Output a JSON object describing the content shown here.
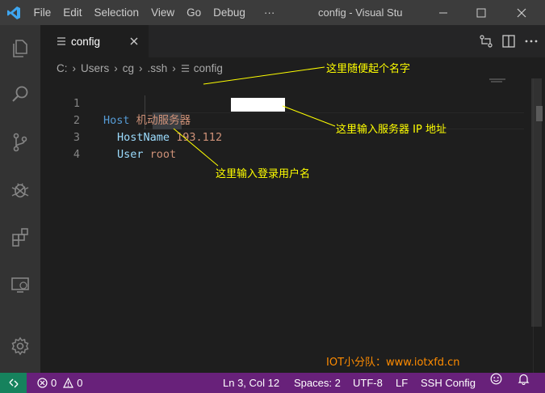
{
  "window": {
    "title": "config - Visual Stu",
    "menu": [
      "File",
      "Edit",
      "Selection",
      "View",
      "Go",
      "Debug",
      "···"
    ]
  },
  "activitybar": {
    "icons": [
      "files-icon",
      "search-icon",
      "source-control-icon",
      "debug-icon",
      "extensions-icon",
      "remote-explorer-icon",
      "settings-gear-icon"
    ]
  },
  "tab": {
    "label": "config",
    "close": "×"
  },
  "breadcrumbs": {
    "parts": [
      "C:",
      "Users",
      "cg",
      ".ssh"
    ],
    "file": "config"
  },
  "editor": {
    "lines": [
      {
        "num": "1",
        "key": "Host",
        "value": "机动服务器"
      },
      {
        "num": "2",
        "key": "HostName",
        "value": "193.112"
      },
      {
        "num": "3",
        "key": "User",
        "value": "root"
      },
      {
        "num": "4",
        "key": "",
        "value": ""
      }
    ]
  },
  "annotations": {
    "a1": "这里随便起个名字",
    "a2": "这里输入服务器 IP 地址",
    "a3": "这里输入登录用户名",
    "watermark": "IOT小分队：www.iotxfd.cn"
  },
  "statusbar": {
    "errors": "0",
    "warnings": "0",
    "position": "Ln 3, Col 12",
    "spaces": "Spaces: 2",
    "encoding": "UTF-8",
    "eol": "LF",
    "language": "SSH Config"
  },
  "colors": {
    "statusbar_bg": "#68217a",
    "remote_bg": "#16825d",
    "annotation": "#ffff00",
    "watermark": "#ff8c00"
  }
}
